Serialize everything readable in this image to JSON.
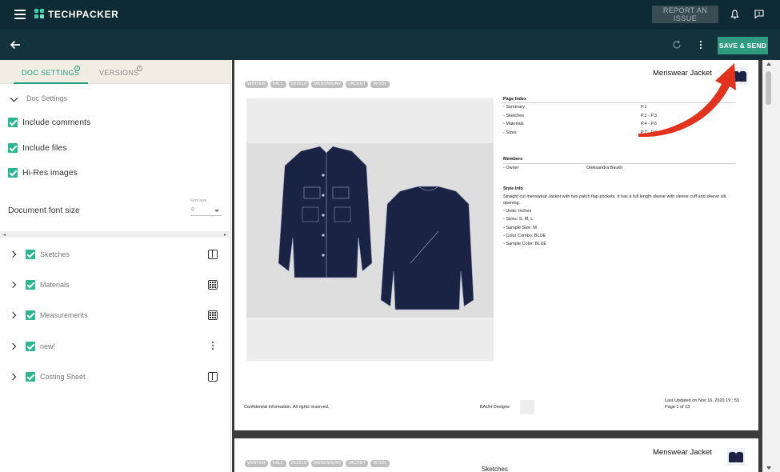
{
  "app": {
    "brand": "TECHPACKER",
    "report_label": "REPORT AN ISSUE",
    "save_label": "SAVE & SEND"
  },
  "tabs": [
    {
      "label": "DOC SETTINGS",
      "active": true
    },
    {
      "label": "VERSIONS",
      "active": false
    }
  ],
  "settings": {
    "section_label": "Doc Settings",
    "options": [
      {
        "label": "Include comments",
        "checked": true
      },
      {
        "label": "Include files",
        "checked": true
      },
      {
        "label": "Hi-Res images",
        "checked": true
      }
    ],
    "font_label": "Document font size",
    "font_caption": "Font size",
    "font_value": "8"
  },
  "sections": [
    {
      "label": "Sketches",
      "icon": "columns-icon",
      "checked": true
    },
    {
      "label": "Materials",
      "icon": "grid-icon",
      "checked": true
    },
    {
      "label": "Measurements",
      "icon": "grid-icon",
      "checked": true
    },
    {
      "label": "new!",
      "icon": "more-vert-icon",
      "checked": true
    },
    {
      "label": "Costing Sheet",
      "icon": "columns-icon",
      "checked": true
    }
  ],
  "doc": {
    "tags": [
      "WINTER",
      "FALL",
      "201819",
      "MENSWEAR",
      "JACKET",
      "WOOL"
    ],
    "title": "Menswear Jacket",
    "page_index": {
      "heading": "Page Index",
      "rows": [
        {
          "name": "- Summary",
          "page": "P.1"
        },
        {
          "name": "- Sketches",
          "page": "P.2 - P.3"
        },
        {
          "name": "- Materials",
          "page": "P.4 - P.6"
        },
        {
          "name": "- Sizes",
          "page": "P.7 - P.8"
        }
      ]
    },
    "members": {
      "heading": "Members",
      "role": "- Owner",
      "name": "Oleksandra Baukh"
    },
    "style_info": {
      "heading": "Style Info",
      "description": "Straight cut menswear Jacket with two patch flap pockets. It has a full length sleeve with sleeve cuff and sleeve slit opening.",
      "lines": [
        "- Units: Inches",
        "- Sizes: S, M, L",
        "- Sample Size: M",
        "- Color Combo: BLUE",
        "- Sample Color: BLUE"
      ]
    },
    "footer": {
      "left": "Confidential Information. All rights reserved.",
      "middle": "BAUH Designs",
      "updated": "Last Updated on Nov 16, 2020 19 : 53",
      "page": "Page 1 of 13"
    },
    "page2_subtitle": "Sketches"
  },
  "colors": {
    "topbar": "#0e2a34",
    "toolbar": "#14323c",
    "accent": "#2bb592",
    "save": "#2f9c82",
    "jacket": "#1b2344",
    "arrow": "#e0321c"
  }
}
